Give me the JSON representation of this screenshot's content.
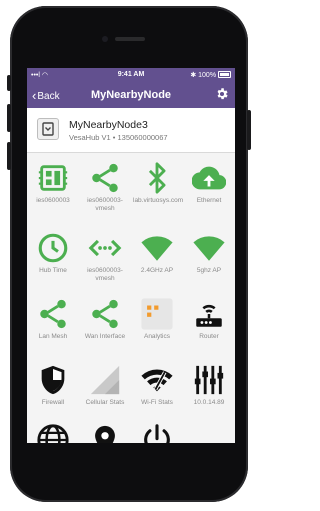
{
  "status": {
    "carrier": "•••l",
    "wifi": "◠",
    "time": "9:41 AM",
    "bluetooth": "✱",
    "battery": "100%"
  },
  "nav": {
    "back_label": "Back",
    "title": "MyNearbyNode",
    "settings_icon": "gear-icon"
  },
  "node": {
    "name": "MyNearbyNode3",
    "subtitle": "VesaHub V1 • 135060000067"
  },
  "colors": {
    "header": "#62508f",
    "accent_green": "#4caf50",
    "dark": "#111111"
  },
  "tiles": [
    {
      "label": "ies0600003",
      "icon": "chip-icon"
    },
    {
      "label": "ies0600003-vmesh",
      "icon": "share-icon"
    },
    {
      "label": "lab.virtuosys.com",
      "icon": "bluetooth-icon"
    },
    {
      "label": "Ethernet",
      "icon": "cloud-upload-icon"
    },
    {
      "label": "Hub Time",
      "icon": "clock-icon"
    },
    {
      "label": "ies0600003-vmesh",
      "icon": "mesh-arrows-icon"
    },
    {
      "label": "2.4GHz AP",
      "icon": "wifi-icon"
    },
    {
      "label": "5ghz AP",
      "icon": "wifi-icon"
    },
    {
      "label": "Lan Mesh",
      "icon": "share-icon"
    },
    {
      "label": "Wan Interface",
      "icon": "share-icon"
    },
    {
      "label": "Analytics",
      "icon": "analytics-icon"
    },
    {
      "label": "Router",
      "icon": "router-icon"
    },
    {
      "label": "Firewall",
      "icon": "shield-icon"
    },
    {
      "label": "Cellular Stats",
      "icon": "cellular-icon"
    },
    {
      "label": "Wi-Fi Stats",
      "icon": "wifi-speed-icon"
    },
    {
      "label": "10.0.14.89",
      "icon": "sliders-icon"
    },
    {
      "label": "",
      "icon": "globe-icon"
    },
    {
      "label": "",
      "icon": "location-pin-icon"
    },
    {
      "label": "",
      "icon": "power-icon"
    }
  ]
}
